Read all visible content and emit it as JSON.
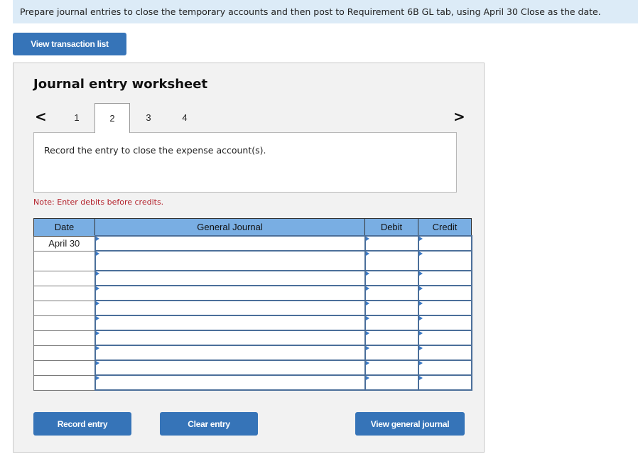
{
  "instruction": "Prepare journal entries to close the temporary accounts and then post to Requirement 6B GL tab, using April 30 Close as the date.",
  "buttons": {
    "view_transaction_list": "View transaction list",
    "record_entry": "Record entry",
    "clear_entry": "Clear entry",
    "view_general_journal": "View general journal"
  },
  "worksheet": {
    "title": "Journal entry worksheet",
    "prev_icon": "chevron-left-icon",
    "next_icon": "chevron-right-icon",
    "prev_glyph": "<",
    "next_glyph": ">",
    "tabs": [
      {
        "label": "1",
        "active": false
      },
      {
        "label": "2",
        "active": true
      },
      {
        "label": "3",
        "active": false
      },
      {
        "label": "4",
        "active": false
      }
    ],
    "description": "Record the entry to close the expense account(s).",
    "note": "Note: Enter debits before credits."
  },
  "journal": {
    "columns": [
      "Date",
      "General Journal",
      "Debit",
      "Credit"
    ],
    "rows": [
      {
        "date": "April 30",
        "account": "",
        "debit": "",
        "credit": ""
      },
      {
        "date": "",
        "account": "",
        "debit": "",
        "credit": ""
      },
      {
        "date": "",
        "account": "",
        "debit": "",
        "credit": ""
      },
      {
        "date": "",
        "account": "",
        "debit": "",
        "credit": ""
      },
      {
        "date": "",
        "account": "",
        "debit": "",
        "credit": ""
      },
      {
        "date": "",
        "account": "",
        "debit": "",
        "credit": ""
      },
      {
        "date": "",
        "account": "",
        "debit": "",
        "credit": ""
      },
      {
        "date": "",
        "account": "",
        "debit": "",
        "credit": ""
      },
      {
        "date": "",
        "account": "",
        "debit": "",
        "credit": ""
      },
      {
        "date": "",
        "account": "",
        "debit": "",
        "credit": ""
      }
    ]
  }
}
